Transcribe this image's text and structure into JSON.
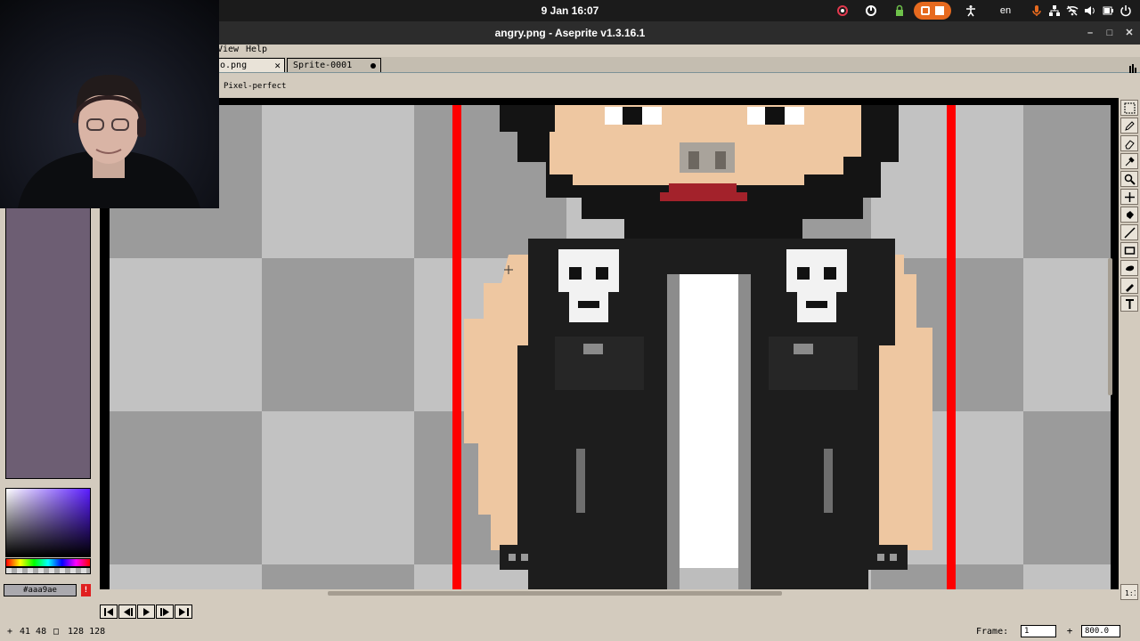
{
  "system": {
    "clock": "9 Jan  16:07",
    "language": "en"
  },
  "window": {
    "title": "angry.png - Aseprite v1.3.16.1"
  },
  "menu": {
    "view": "View",
    "help": "Help"
  },
  "tabs": [
    {
      "label": "angry.png",
      "visible_label": "o.png",
      "closable": true,
      "active": true
    },
    {
      "label": "Sprite-0001",
      "modified": true,
      "active": false
    }
  ],
  "context_bar": {
    "pixel_perfect": "Pixel-perfect"
  },
  "colors": {
    "foreground": "#aaa9ae",
    "background": "#cccccd",
    "palette_bg": "#6d5e73",
    "accent_orange": "#e66a1f",
    "guide_red": "#ff0000"
  },
  "status": {
    "cursor_pos": "41 48",
    "sprite_size": "128 128",
    "frame_label": "Frame:",
    "frame_value": "1",
    "zoom_value": "800.0"
  },
  "tools": [
    "marquee-icon",
    "pencil-icon",
    "eraser-icon",
    "eyedropper-icon",
    "zoom-icon",
    "move-icon",
    "paint-bucket-icon",
    "line-icon",
    "rectangle-icon",
    "ellipse-icon",
    "smudge-icon",
    "text-icon"
  ]
}
